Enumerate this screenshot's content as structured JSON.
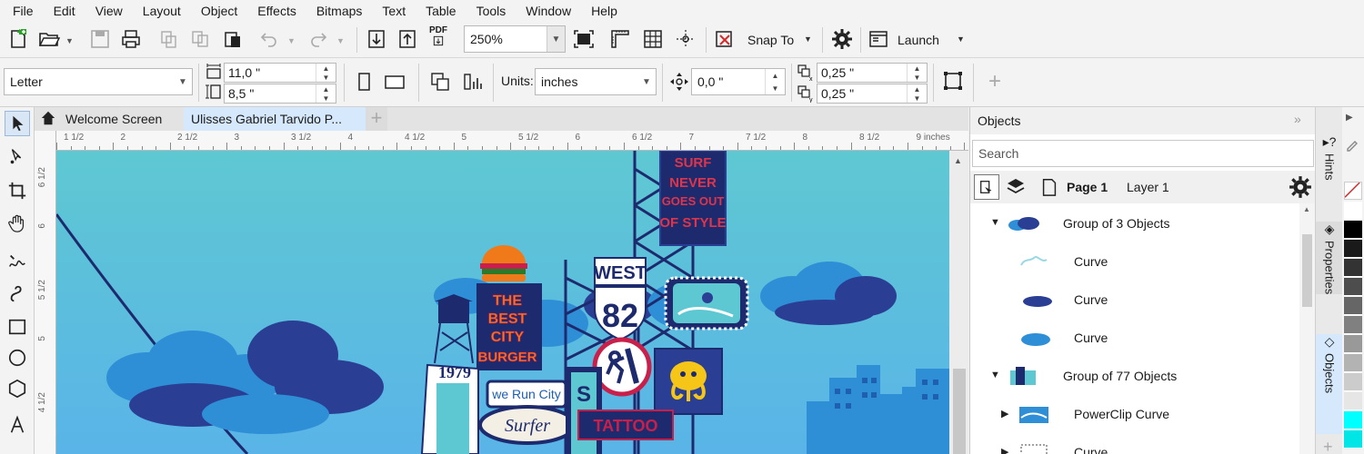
{
  "menu": [
    "File",
    "Edit",
    "View",
    "Layout",
    "Object",
    "Effects",
    "Bitmaps",
    "Text",
    "Table",
    "Tools",
    "Window",
    "Help"
  ],
  "toolbar": {
    "pdf_label": "PDF",
    "zoom": "250%",
    "snap_to": "Snap To",
    "launch": "Launch"
  },
  "property_bar": {
    "page_size": "Letter",
    "width": "11,0 \"",
    "height": "8,5 \"",
    "units_label": "Units:",
    "units": "inches",
    "nudge": "0,0 \"",
    "dup_x": "0,25 \"",
    "dup_y": "0,25 \""
  },
  "tabs": [
    "Welcome Screen",
    "Ulisses Gabriel Tarvido P..."
  ],
  "ruler": {
    "h_labels": [
      "1 1/2",
      "2",
      "2 1/2",
      "3",
      "3 1/2",
      "4",
      "4 1/2",
      "5",
      "5 1/2",
      "6",
      "6 1/2",
      "7",
      "7 1/2",
      "8",
      "8 1/2",
      "9 inches"
    ],
    "v_labels": [
      "6 1/2",
      "6",
      "5 1/2",
      "5",
      "4 1/2"
    ]
  },
  "artwork": {
    "burger_sign": [
      "THE",
      "BEST",
      "CITY",
      "BURGER"
    ],
    "surf_sign": [
      "SURF",
      "NEVER",
      "GOES OUT",
      "OF STYLE"
    ],
    "west_sign": "WEST",
    "route_number": "82",
    "year": "1979",
    "we_run_city": "we Run City",
    "surfer": "Surfer",
    "tattoo": "TATTOO",
    "colors": {
      "sky": "#5ec8d2",
      "cloud_light": "#2f8fd6",
      "cloud_dark": "#2a3f94",
      "navy": "#1e2a6e",
      "neon_orange": "#f07a1a",
      "neon_red": "#c8204a"
    }
  },
  "objects_panel": {
    "title": "Objects",
    "search_placeholder": "Search",
    "page": "Page 1",
    "layer": "Layer 1",
    "items": [
      {
        "label": "Group of 3 Objects",
        "icon": "chevron-down-icon"
      },
      {
        "label": "Curve"
      },
      {
        "label": "Curve"
      },
      {
        "label": "Curve"
      },
      {
        "label": "Group of 77 Objects",
        "icon": "chevron-down-icon"
      },
      {
        "label": "PowerClip Curve",
        "icon": "chevron-right-icon"
      },
      {
        "label": "Curve",
        "icon": "chevron-right-icon"
      }
    ]
  },
  "dock": [
    "Hints",
    "Properties",
    "Objects"
  ],
  "palette": [
    "#ffffff",
    "#000000",
    "#1a1a1a",
    "#333333",
    "#4d4d4d",
    "#666666",
    "#808080",
    "#999999",
    "#b3b3b3",
    "#cccccc",
    "#e6e6e6",
    "#00ffff",
    "#00e6e6"
  ]
}
